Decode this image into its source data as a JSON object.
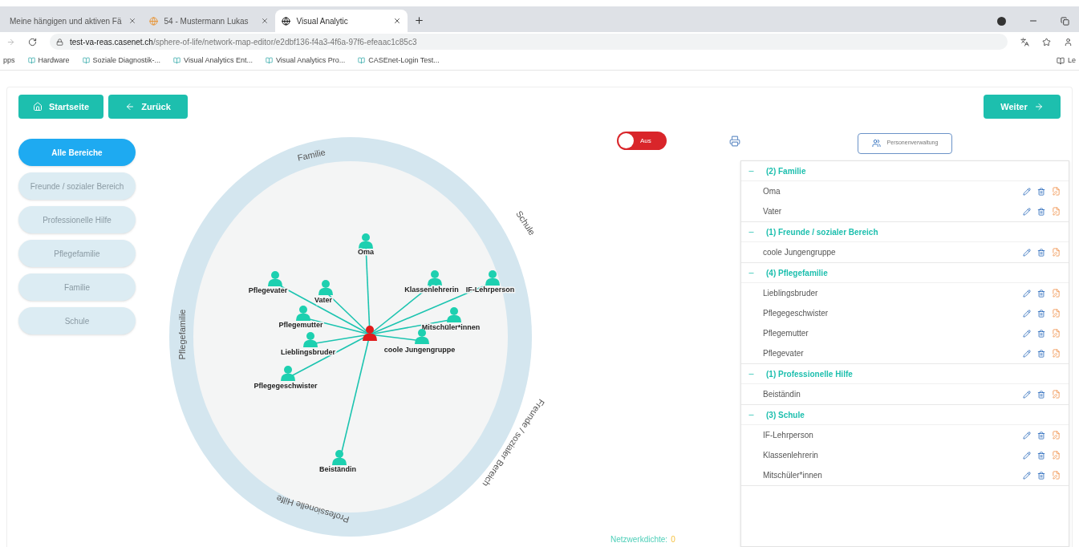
{
  "browser": {
    "tabs": [
      {
        "title": "Meine hängigen und aktiven Fä",
        "selected": false
      },
      {
        "title": "54 - Mustermann Lukas",
        "selected": false
      },
      {
        "title": "Visual Analytic",
        "selected": true
      }
    ],
    "address": {
      "domain": "test-va-reas.casenet.ch",
      "path": "/sphere-of-life/network-map-editor/e2dbf136-f4a3-4f6a-97f6-efeaac1c85c3"
    },
    "bookmarks": [
      "pps",
      "Hardware",
      "Soziale Diagnostik-...",
      "Visual Analytics Ent...",
      "Visual Analytics Pro...",
      "CASEnet-Login Test..."
    ],
    "bookmarks_right": "Le"
  },
  "toolbar": {
    "home": "Startseite",
    "back": "Zurück",
    "next": "Weiter"
  },
  "sidebar": {
    "items": [
      {
        "label": "Alle Bereiche",
        "selected": true
      },
      {
        "label": "Freunde / sozialer Bereich",
        "selected": false
      },
      {
        "label": "Professionelle Hilfe",
        "selected": false
      },
      {
        "label": "Pflegefamilie",
        "selected": false
      },
      {
        "label": "Familie",
        "selected": false
      },
      {
        "label": "Schule",
        "selected": false
      }
    ]
  },
  "map": {
    "toggle": {
      "label": "Aus",
      "on": false
    },
    "sectors": [
      "Familie",
      "Schule",
      "Freunde / sozialer Bereich",
      "Professionelle Hilfe",
      "Pflegefamilie"
    ],
    "persons": [
      "Oma",
      "Pflegevater",
      "Vater",
      "Klassenlehrerin",
      "IF-Lehrperson",
      "Pflegemutter",
      "Mitschüler*innen",
      "Lieblingsbruder",
      "coole Jungengruppe",
      "Pflegegeschwister",
      "Beiständin"
    ],
    "density": {
      "label": "Netzwerkdichte:",
      "value": "0"
    }
  },
  "panel": {
    "manage_button": "Personenverwaltung",
    "groups": [
      {
        "title": "(2) Familie",
        "expanded": true,
        "items": [
          "Oma",
          "Vater"
        ]
      },
      {
        "title": "(1) Freunde / sozialer Bereich",
        "expanded": true,
        "items": [
          "coole Jungengruppe"
        ]
      },
      {
        "title": "(4) Pflegefamilie",
        "expanded": true,
        "items": [
          "Lieblingsbruder",
          "Pflegegeschwister",
          "Pflegemutter",
          "Pflegevater"
        ]
      },
      {
        "title": "(1) Professionelle Hilfe",
        "expanded": true,
        "items": [
          "Beiständin"
        ]
      },
      {
        "title": "(3) Schule",
        "expanded": true,
        "items": [
          "IF-Lehrperson",
          "Klassenlehrerin",
          "Mitschüler*innen"
        ]
      }
    ]
  }
}
